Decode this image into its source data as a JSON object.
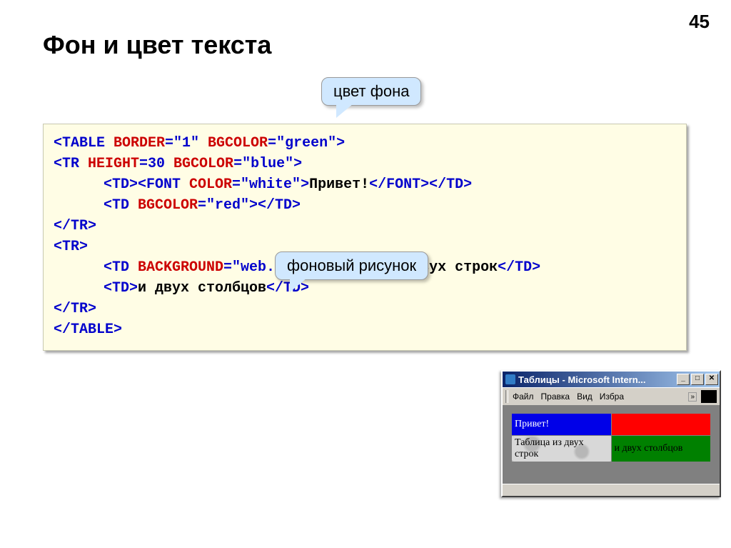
{
  "page_number": "45",
  "title": "Фон и цвет текста",
  "callouts": {
    "bg_color": "цвет фона",
    "bg_image": "фоновый рисунок"
  },
  "code": {
    "l1_a": "<TABLE ",
    "l1_b": "BORDER",
    "l1_c": "=\"1\" ",
    "l1_d": "BGCOLOR",
    "l1_e": "=\"green\">",
    "l2_a": "<TR ",
    "l2_b": "HEIGHT",
    "l2_c": "=30 ",
    "l2_d": "BGCOLOR",
    "l2_e": "=\"blue\">",
    "l3_a": "<TD>",
    "l3_b": "<FONT ",
    "l3_c": "COLOR",
    "l3_d": "=\"white\">",
    "l3_e": "Привет!",
    "l3_f": "</FONT>",
    "l3_g": "</TD>",
    "l4_a": "<TD ",
    "l4_b": "BGCOLOR",
    "l4_c": "=\"red\">",
    "l4_d": "</TD>",
    "l5": "</TR>",
    "l6": "<TR>",
    "l7_a": "<TD ",
    "l7_b": "BACKGROUND",
    "l7_c": "=\"web.jpg\">",
    "l7_d": "Таблица из двух строк",
    "l7_e": "</TD>",
    "l8_a": "<TD>",
    "l8_b": "и двух столбцов",
    "l8_c": "</TD>",
    "l9": "</TR>",
    "l10": "</TABLE>"
  },
  "browser": {
    "title": "Таблицы - Microsoft Intern...",
    "menu": {
      "file": "Файл",
      "edit": "Правка",
      "view": "Вид",
      "fav": "Избра"
    },
    "cells": {
      "c1": "Привет!",
      "c2": "",
      "c3": "Таблица из двух строк",
      "c4": "и двух столбцов"
    },
    "buttons": {
      "min": "_",
      "max": "□",
      "close": "✕"
    }
  }
}
